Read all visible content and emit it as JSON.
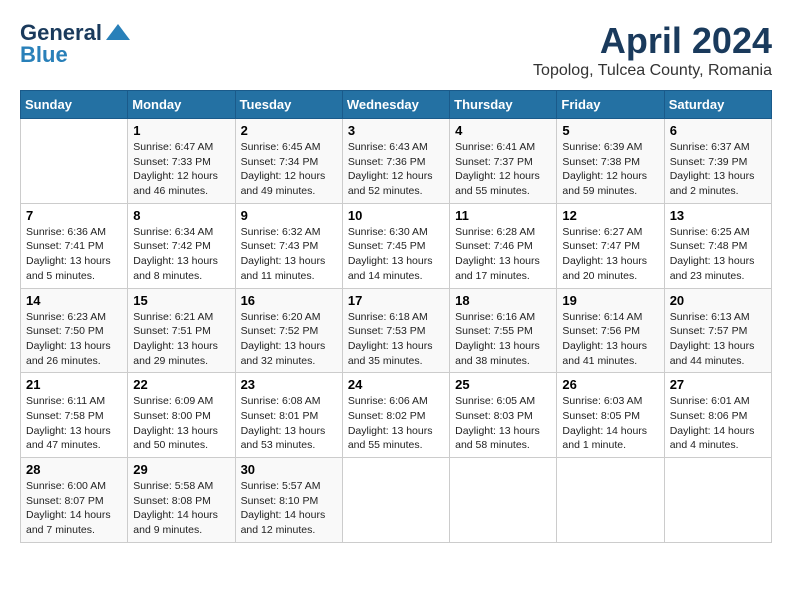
{
  "header": {
    "logo_line1": "General",
    "logo_line2": "Blue",
    "month": "April 2024",
    "location": "Topolog, Tulcea County, Romania"
  },
  "weekdays": [
    "Sunday",
    "Monday",
    "Tuesday",
    "Wednesday",
    "Thursday",
    "Friday",
    "Saturday"
  ],
  "weeks": [
    [
      {
        "day": "",
        "info": ""
      },
      {
        "day": "1",
        "info": "Sunrise: 6:47 AM\nSunset: 7:33 PM\nDaylight: 12 hours\nand 46 minutes."
      },
      {
        "day": "2",
        "info": "Sunrise: 6:45 AM\nSunset: 7:34 PM\nDaylight: 12 hours\nand 49 minutes."
      },
      {
        "day": "3",
        "info": "Sunrise: 6:43 AM\nSunset: 7:36 PM\nDaylight: 12 hours\nand 52 minutes."
      },
      {
        "day": "4",
        "info": "Sunrise: 6:41 AM\nSunset: 7:37 PM\nDaylight: 12 hours\nand 55 minutes."
      },
      {
        "day": "5",
        "info": "Sunrise: 6:39 AM\nSunset: 7:38 PM\nDaylight: 12 hours\nand 59 minutes."
      },
      {
        "day": "6",
        "info": "Sunrise: 6:37 AM\nSunset: 7:39 PM\nDaylight: 13 hours\nand 2 minutes."
      }
    ],
    [
      {
        "day": "7",
        "info": "Sunrise: 6:36 AM\nSunset: 7:41 PM\nDaylight: 13 hours\nand 5 minutes."
      },
      {
        "day": "8",
        "info": "Sunrise: 6:34 AM\nSunset: 7:42 PM\nDaylight: 13 hours\nand 8 minutes."
      },
      {
        "day": "9",
        "info": "Sunrise: 6:32 AM\nSunset: 7:43 PM\nDaylight: 13 hours\nand 11 minutes."
      },
      {
        "day": "10",
        "info": "Sunrise: 6:30 AM\nSunset: 7:45 PM\nDaylight: 13 hours\nand 14 minutes."
      },
      {
        "day": "11",
        "info": "Sunrise: 6:28 AM\nSunset: 7:46 PM\nDaylight: 13 hours\nand 17 minutes."
      },
      {
        "day": "12",
        "info": "Sunrise: 6:27 AM\nSunset: 7:47 PM\nDaylight: 13 hours\nand 20 minutes."
      },
      {
        "day": "13",
        "info": "Sunrise: 6:25 AM\nSunset: 7:48 PM\nDaylight: 13 hours\nand 23 minutes."
      }
    ],
    [
      {
        "day": "14",
        "info": "Sunrise: 6:23 AM\nSunset: 7:50 PM\nDaylight: 13 hours\nand 26 minutes."
      },
      {
        "day": "15",
        "info": "Sunrise: 6:21 AM\nSunset: 7:51 PM\nDaylight: 13 hours\nand 29 minutes."
      },
      {
        "day": "16",
        "info": "Sunrise: 6:20 AM\nSunset: 7:52 PM\nDaylight: 13 hours\nand 32 minutes."
      },
      {
        "day": "17",
        "info": "Sunrise: 6:18 AM\nSunset: 7:53 PM\nDaylight: 13 hours\nand 35 minutes."
      },
      {
        "day": "18",
        "info": "Sunrise: 6:16 AM\nSunset: 7:55 PM\nDaylight: 13 hours\nand 38 minutes."
      },
      {
        "day": "19",
        "info": "Sunrise: 6:14 AM\nSunset: 7:56 PM\nDaylight: 13 hours\nand 41 minutes."
      },
      {
        "day": "20",
        "info": "Sunrise: 6:13 AM\nSunset: 7:57 PM\nDaylight: 13 hours\nand 44 minutes."
      }
    ],
    [
      {
        "day": "21",
        "info": "Sunrise: 6:11 AM\nSunset: 7:58 PM\nDaylight: 13 hours\nand 47 minutes."
      },
      {
        "day": "22",
        "info": "Sunrise: 6:09 AM\nSunset: 8:00 PM\nDaylight: 13 hours\nand 50 minutes."
      },
      {
        "day": "23",
        "info": "Sunrise: 6:08 AM\nSunset: 8:01 PM\nDaylight: 13 hours\nand 53 minutes."
      },
      {
        "day": "24",
        "info": "Sunrise: 6:06 AM\nSunset: 8:02 PM\nDaylight: 13 hours\nand 55 minutes."
      },
      {
        "day": "25",
        "info": "Sunrise: 6:05 AM\nSunset: 8:03 PM\nDaylight: 13 hours\nand 58 minutes."
      },
      {
        "day": "26",
        "info": "Sunrise: 6:03 AM\nSunset: 8:05 PM\nDaylight: 14 hours\nand 1 minute."
      },
      {
        "day": "27",
        "info": "Sunrise: 6:01 AM\nSunset: 8:06 PM\nDaylight: 14 hours\nand 4 minutes."
      }
    ],
    [
      {
        "day": "28",
        "info": "Sunrise: 6:00 AM\nSunset: 8:07 PM\nDaylight: 14 hours\nand 7 minutes."
      },
      {
        "day": "29",
        "info": "Sunrise: 5:58 AM\nSunset: 8:08 PM\nDaylight: 14 hours\nand 9 minutes."
      },
      {
        "day": "30",
        "info": "Sunrise: 5:57 AM\nSunset: 8:10 PM\nDaylight: 14 hours\nand 12 minutes."
      },
      {
        "day": "",
        "info": ""
      },
      {
        "day": "",
        "info": ""
      },
      {
        "day": "",
        "info": ""
      },
      {
        "day": "",
        "info": ""
      }
    ]
  ]
}
